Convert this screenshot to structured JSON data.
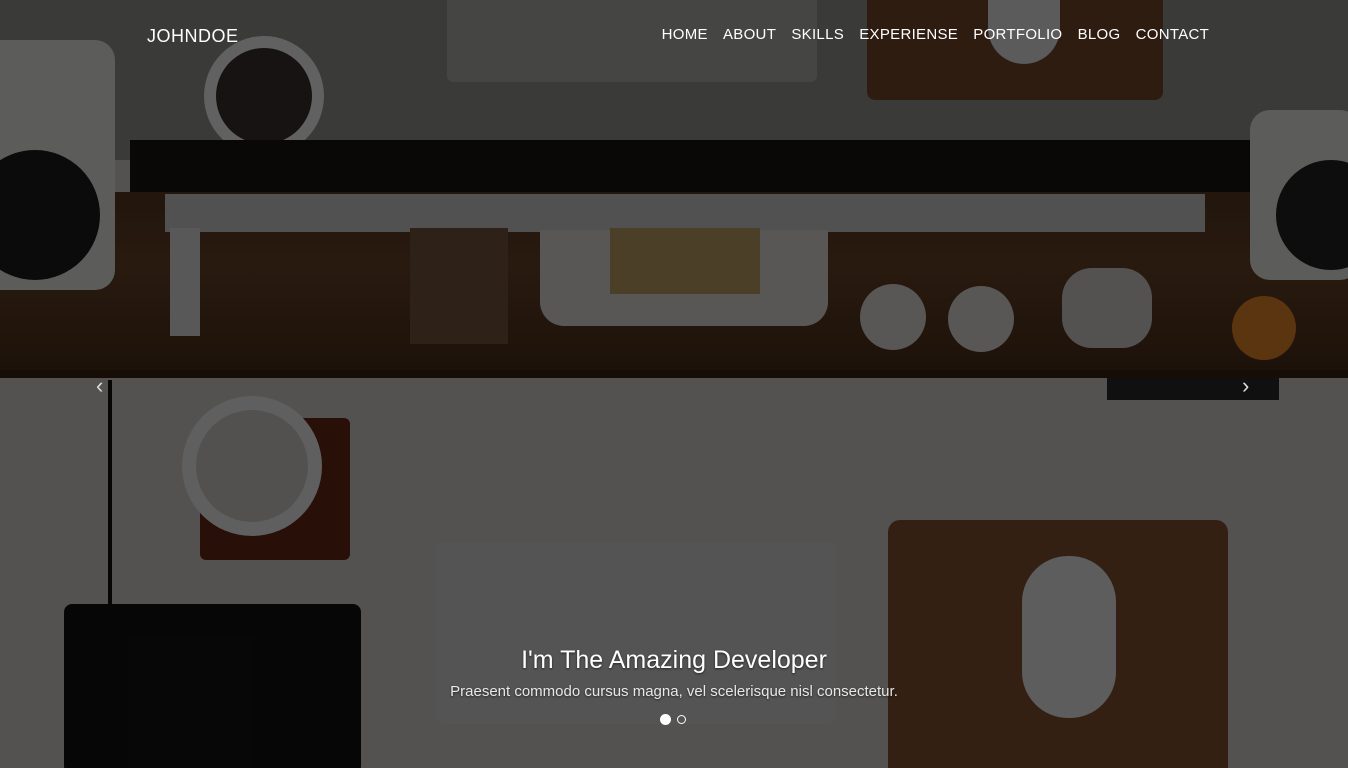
{
  "navbar": {
    "brand": "JOHNDOE",
    "menu": [
      {
        "label": "HOME"
      },
      {
        "label": "ABOUT"
      },
      {
        "label": "SKILLS"
      },
      {
        "label": "EXPERIENSE"
      },
      {
        "label": "PORTFOLIO"
      },
      {
        "label": "BLOG"
      },
      {
        "label": "CONTACT"
      }
    ]
  },
  "carousel": {
    "prev_icon": "‹",
    "next_icon": "›",
    "title": "I'm The Amazing Developer",
    "subtitle": "Praesent commodo cursus magna, vel scelerisque nisl consectetur.",
    "slide_count": 2,
    "active_slide": 1
  },
  "colors": {
    "overlay": "rgba(0,0,0,0.62)",
    "text": "#ffffff"
  }
}
